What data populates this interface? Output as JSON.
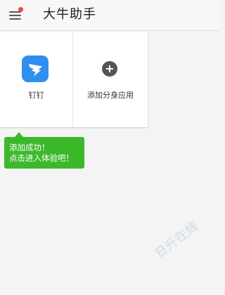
{
  "app_bar": {
    "title": "大牛助手",
    "menu_icon": "hamburger-menu-icon",
    "notification_dot_color": "#f2424b"
  },
  "apps": [
    {
      "label": "钉钉",
      "icon": "dingtalk-icon",
      "icon_color": "#2e8ff0"
    },
    {
      "label": "添加分身应用",
      "icon": "add-circle-icon",
      "icon_color": "#555555"
    }
  ],
  "tooltip": {
    "line1": "添加成功！",
    "line2": "点击进入体验吧！",
    "color": "#3cb92b"
  },
  "watermark": {
    "text": "日升在线"
  }
}
